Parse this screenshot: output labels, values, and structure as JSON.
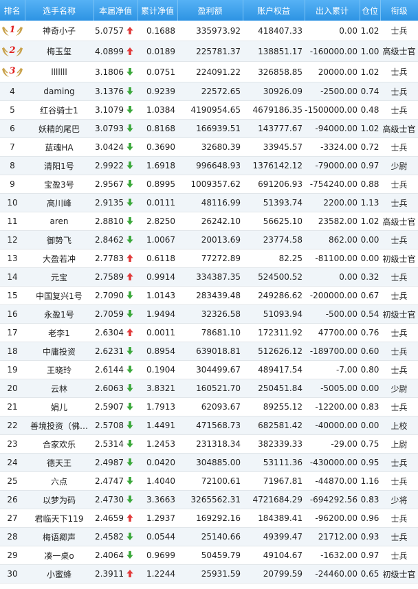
{
  "colors": {
    "header_bg": "#3fa3ee",
    "row_alt": "#f0f5f9",
    "arrow_up": "#e23b3b",
    "arrow_down": "#3aa83a",
    "medal": "#c9a24c"
  },
  "headers": {
    "rank": "排名",
    "name": "选手名称",
    "nav": "本届净值",
    "cum_nav": "累计净值",
    "profit": "盈利额",
    "equity": "账户权益",
    "flow": "出入累计",
    "position": "仓位",
    "title": "衔级"
  },
  "rows": [
    {
      "rank": "1",
      "medal": true,
      "name": "神奇小子",
      "nav": "5.0757",
      "trend": "up",
      "cum_nav": "0.1688",
      "profit": "335973.92",
      "equity": "418407.33",
      "flow": "0.00",
      "position": "1.02",
      "title": "士兵"
    },
    {
      "rank": "2",
      "medal": true,
      "name": "梅玉玺",
      "nav": "4.0899",
      "trend": "up",
      "cum_nav": "0.0189",
      "profit": "225781.37",
      "equity": "138851.17",
      "flow": "-160000.00",
      "position": "1.00",
      "title": "高级士官"
    },
    {
      "rank": "3",
      "medal": true,
      "name": "lllllll",
      "nav": "3.1806",
      "trend": "down",
      "cum_nav": "0.0751",
      "profit": "224091.22",
      "equity": "326858.85",
      "flow": "20000.00",
      "position": "1.02",
      "title": "士兵"
    },
    {
      "rank": "4",
      "medal": false,
      "name": "daming",
      "nav": "3.1376",
      "trend": "down",
      "cum_nav": "0.9239",
      "profit": "22572.65",
      "equity": "30926.09",
      "flow": "-2500.00",
      "position": "0.74",
      "title": "士兵"
    },
    {
      "rank": "5",
      "medal": false,
      "name": "红谷骑士1",
      "nav": "3.1079",
      "trend": "down",
      "cum_nav": "1.0384",
      "profit": "4190954.65",
      "equity": "4679186.35",
      "flow": "-1500000.00",
      "position": "0.48",
      "title": "士兵"
    },
    {
      "rank": "6",
      "medal": false,
      "name": "妖精的尾巴",
      "nav": "3.0793",
      "trend": "down",
      "cum_nav": "0.8168",
      "profit": "166939.51",
      "equity": "143777.67",
      "flow": "-94000.00",
      "position": "1.02",
      "title": "高级士官"
    },
    {
      "rank": "7",
      "medal": false,
      "name": "蓝魂HA",
      "nav": "3.0424",
      "trend": "down",
      "cum_nav": "0.3690",
      "profit": "32680.39",
      "equity": "33945.57",
      "flow": "-3324.00",
      "position": "0.72",
      "title": "士兵"
    },
    {
      "rank": "8",
      "medal": false,
      "name": "清阳1号",
      "nav": "2.9922",
      "trend": "down",
      "cum_nav": "1.6918",
      "profit": "996648.93",
      "equity": "1376142.12",
      "flow": "-79000.00",
      "position": "0.97",
      "title": "少尉"
    },
    {
      "rank": "9",
      "medal": false,
      "name": "宝盈3号",
      "nav": "2.9567",
      "trend": "down",
      "cum_nav": "0.8995",
      "profit": "1009357.62",
      "equity": "691206.93",
      "flow": "-754240.00",
      "position": "0.88",
      "title": "士兵"
    },
    {
      "rank": "10",
      "medal": false,
      "name": "高川峰",
      "nav": "2.9135",
      "trend": "down",
      "cum_nav": "0.0111",
      "profit": "48116.99",
      "equity": "51393.74",
      "flow": "2200.00",
      "position": "1.13",
      "title": "士兵"
    },
    {
      "rank": "11",
      "medal": false,
      "name": "aren",
      "nav": "2.8810",
      "trend": "down",
      "cum_nav": "2.8250",
      "profit": "26242.10",
      "equity": "56625.10",
      "flow": "23582.00",
      "position": "1.02",
      "title": "高级士官"
    },
    {
      "rank": "12",
      "medal": false,
      "name": "御势飞",
      "nav": "2.8462",
      "trend": "down",
      "cum_nav": "1.0067",
      "profit": "20013.69",
      "equity": "23774.58",
      "flow": "862.00",
      "position": "0.00",
      "title": "士兵"
    },
    {
      "rank": "13",
      "medal": false,
      "name": "大盈若冲",
      "nav": "2.7783",
      "trend": "up",
      "cum_nav": "0.6118",
      "profit": "77272.89",
      "equity": "82.25",
      "flow": "-81100.00",
      "position": "0.00",
      "title": "初级士官"
    },
    {
      "rank": "14",
      "medal": false,
      "name": "元宝",
      "nav": "2.7589",
      "trend": "up",
      "cum_nav": "0.9914",
      "profit": "334387.35",
      "equity": "524500.52",
      "flow": "0.00",
      "position": "0.32",
      "title": "士兵"
    },
    {
      "rank": "15",
      "medal": false,
      "name": "中国复兴1号",
      "nav": "2.7090",
      "trend": "down",
      "cum_nav": "1.0143",
      "profit": "283439.48",
      "equity": "249286.62",
      "flow": "-200000.00",
      "position": "0.67",
      "title": "士兵"
    },
    {
      "rank": "16",
      "medal": false,
      "name": "永盈1号",
      "nav": "2.7059",
      "trend": "down",
      "cum_nav": "1.9494",
      "profit": "32326.58",
      "equity": "51093.94",
      "flow": "-500.00",
      "position": "0.54",
      "title": "初级士官"
    },
    {
      "rank": "17",
      "medal": false,
      "name": "老李1",
      "nav": "2.6304",
      "trend": "up",
      "cum_nav": "0.0011",
      "profit": "78681.10",
      "equity": "172311.92",
      "flow": "47700.00",
      "position": "0.76",
      "title": "士兵"
    },
    {
      "rank": "18",
      "medal": false,
      "name": "中庸投资",
      "nav": "2.6231",
      "trend": "down",
      "cum_nav": "0.8954",
      "profit": "639018.81",
      "equity": "512626.12",
      "flow": "-189700.00",
      "position": "0.60",
      "title": "士兵"
    },
    {
      "rank": "19",
      "medal": false,
      "name": "王晓玲",
      "nav": "2.6144",
      "trend": "down",
      "cum_nav": "0.1904",
      "profit": "304499.67",
      "equity": "489417.54",
      "flow": "-7.00",
      "position": "0.80",
      "title": "士兵"
    },
    {
      "rank": "20",
      "medal": false,
      "name": "云林",
      "nav": "2.6063",
      "trend": "down",
      "cum_nav": "3.8321",
      "profit": "160521.70",
      "equity": "250451.84",
      "flow": "-5005.00",
      "position": "0.00",
      "title": "少尉"
    },
    {
      "rank": "21",
      "medal": false,
      "name": "娟儿",
      "nav": "2.5907",
      "trend": "down",
      "cum_nav": "1.7913",
      "profit": "62093.67",
      "equity": "89255.12",
      "flow": "-12200.00",
      "position": "0.83",
      "title": "士兵"
    },
    {
      "rank": "22",
      "medal": false,
      "name": "善境投资（佛…",
      "nav": "2.5708",
      "trend": "down",
      "cum_nav": "1.4491",
      "profit": "471568.73",
      "equity": "682581.42",
      "flow": "-40000.00",
      "position": "0.00",
      "title": "上校"
    },
    {
      "rank": "23",
      "medal": false,
      "name": "合家欢乐",
      "nav": "2.5314",
      "trend": "down",
      "cum_nav": "1.2453",
      "profit": "231318.34",
      "equity": "382339.33",
      "flow": "-29.00",
      "position": "0.75",
      "title": "上尉"
    },
    {
      "rank": "24",
      "medal": false,
      "name": "德天王",
      "nav": "2.4987",
      "trend": "down",
      "cum_nav": "0.0420",
      "profit": "304885.00",
      "equity": "53111.36",
      "flow": "-430000.00",
      "position": "0.95",
      "title": "士兵"
    },
    {
      "rank": "25",
      "medal": false,
      "name": "六点",
      "nav": "2.4747",
      "trend": "down",
      "cum_nav": "1.4040",
      "profit": "72100.61",
      "equity": "71967.81",
      "flow": "-44870.00",
      "position": "1.16",
      "title": "士兵"
    },
    {
      "rank": "26",
      "medal": false,
      "name": "以梦为码",
      "nav": "2.4730",
      "trend": "down",
      "cum_nav": "3.3663",
      "profit": "3265562.31",
      "equity": "4721684.29",
      "flow": "-694292.56",
      "position": "0.83",
      "title": "少将"
    },
    {
      "rank": "27",
      "medal": false,
      "name": "君临天下119",
      "nav": "2.4659",
      "trend": "up",
      "cum_nav": "1.2937",
      "profit": "169292.16",
      "equity": "184389.41",
      "flow": "-96200.00",
      "position": "0.96",
      "title": "士兵"
    },
    {
      "rank": "28",
      "medal": false,
      "name": "梅语卿声",
      "nav": "2.4582",
      "trend": "down",
      "cum_nav": "0.0544",
      "profit": "25140.66",
      "equity": "49399.47",
      "flow": "21712.00",
      "position": "0.93",
      "title": "士兵"
    },
    {
      "rank": "29",
      "medal": false,
      "name": "凑一桌o",
      "nav": "2.4064",
      "trend": "down",
      "cum_nav": "0.9699",
      "profit": "50459.79",
      "equity": "49104.67",
      "flow": "-1632.00",
      "position": "0.97",
      "title": "士兵"
    },
    {
      "rank": "30",
      "medal": false,
      "name": "小蜜蜂",
      "nav": "2.3911",
      "trend": "up",
      "cum_nav": "1.2244",
      "profit": "25931.59",
      "equity": "20799.59",
      "flow": "-24460.00",
      "position": "0.65",
      "title": "初级士官"
    }
  ]
}
